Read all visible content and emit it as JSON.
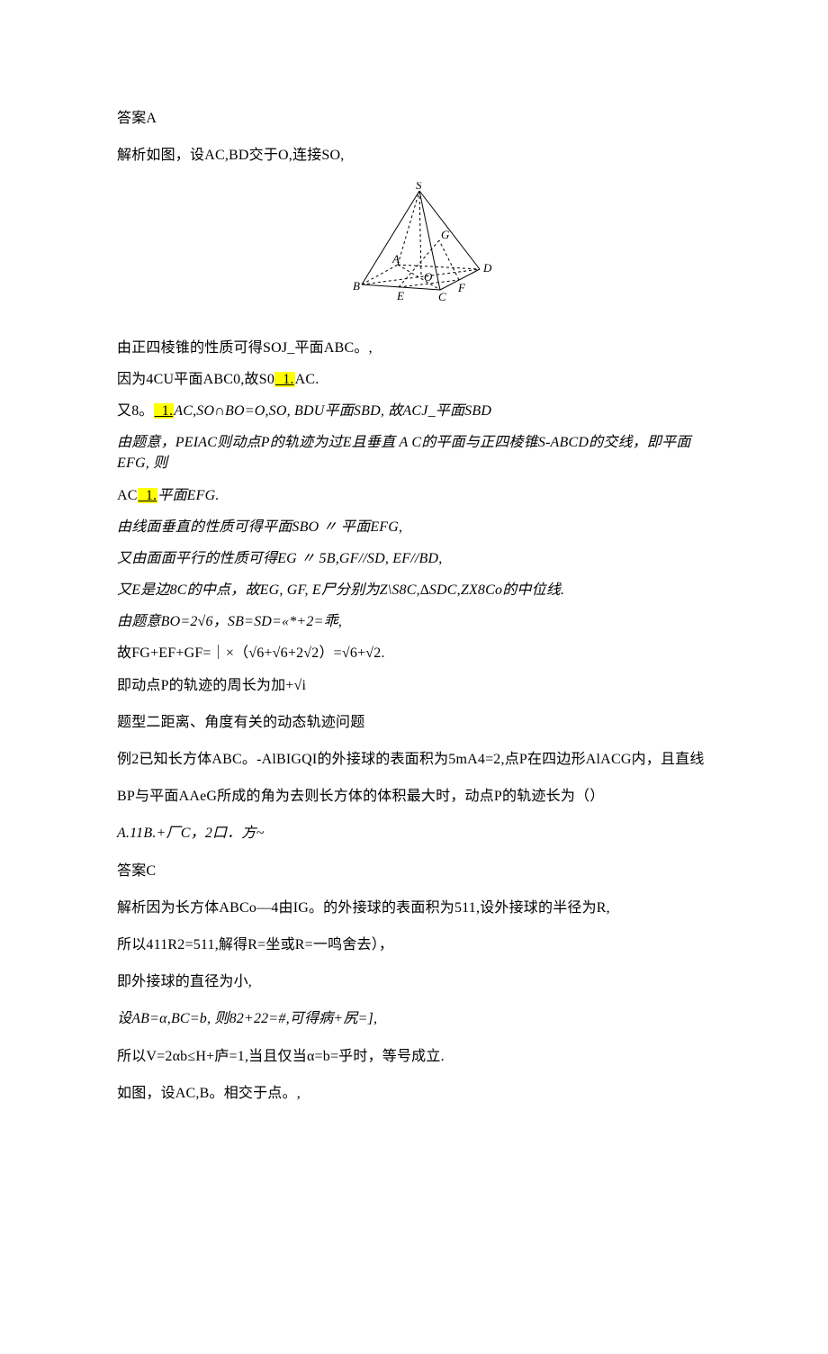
{
  "paragraphs": {
    "p0": "答案A",
    "p1": "解析如图，设AC,BD交于O,连接SO,",
    "p2": "由正四棱锥的性质可得SOJ_平面ABC。,",
    "p3a": "因为4CU平面ABC0,故S0",
    "p3h": "_1.",
    "p3b": "AC.",
    "p4a": "又8。",
    "p4h": "_1.",
    "p4b": "AC,SO∩BO=O,SO, BDU平面SBD, 故ACJ_平面SBD",
    "p5": "由题意，PEIAC则动点P的轨迹为过E且垂直 A C的平面与正四棱锥S-ABCD的交线，即平面EFG, 则",
    "p6a": "AC",
    "p6h": "_1.",
    "p6b": "平面EFG.",
    "p7": "由线面垂直的性质可得平面SBO 〃 平面EFG,",
    "p8": "又由面面平行的性质可得EG 〃 5B,GF//SD, EF//BD,",
    "p9": "又E是边8C的中点，故EG, GF, E尸分别为Z\\S8C,∆SDC,ZX8Co的中位线.",
    "p10": "由题意BO=2√6，SB=SD=«*+2=乖,",
    "p11": "故FG+EF+GF=｜×（√6+√6+2√2）=√6+√2.",
    "p12": "即动点P的轨迹的周长为加+√i",
    "p13": "题型二距离、角度有关的动态轨迹问题",
    "p14": "例2已知长方体ABC。-AlBIGQI的外接球的表面积为5mA4=2,点P在四边形AlACG内，且直线",
    "p15": "BP与平面AAeG所成的角为去则长方体的体积最大时，动点P的轨迹长为（）",
    "p16": "A.11B.+厂C，2口．方~",
    "p17": "答案C",
    "p18": "解析因为长方体ABCo—4由IG。的外接球的表面积为511,设外接球的半径为R,",
    "p19": "所以411R2=511,解得R=坐或R=一鸣舍去），",
    "p20": "即外接球的直径为小,",
    "p21": "设AB=α,BC=b, 则82+22=#,可得病+尻=],",
    "p22": "所以V=2αb≤H+庐=1,当且仅当α=b=乎时，等号成立.",
    "p23": "如图，设AC,B。相交于点。,"
  },
  "figure": {
    "labels": {
      "S": "S",
      "A": "A",
      "B": "B",
      "C": "C",
      "D": "D",
      "E": "E",
      "F": "F",
      "G": "G",
      "O": "O"
    }
  }
}
